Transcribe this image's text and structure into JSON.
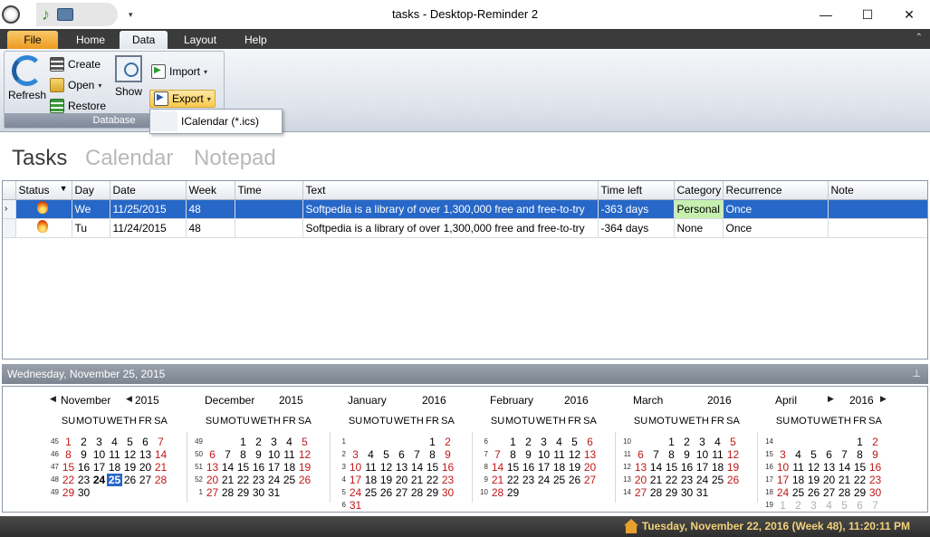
{
  "window": {
    "title": "tasks - Desktop-Reminder 2",
    "minimize": "—",
    "maximize": "☐",
    "close": "✕"
  },
  "qat": {
    "dropdown": "▾"
  },
  "ribbon": {
    "tabs": [
      "File",
      "Home",
      "Data",
      "Layout",
      "Help"
    ],
    "active_tab": "Data",
    "collapse": "⌃",
    "group_label": "Database",
    "buttons": {
      "refresh": "Refresh",
      "create": "Create",
      "open": "Open",
      "restore": "Restore",
      "show": "Show",
      "import": "Import",
      "export": "Export"
    },
    "export_menu": [
      "ICalendar (*.ics)"
    ]
  },
  "views": [
    "Tasks",
    "Calendar",
    "Notepad"
  ],
  "grid": {
    "columns": [
      "Status",
      "Day",
      "Date",
      "Week",
      "Time",
      "Text",
      "Time left",
      "Category",
      "Recurrence",
      "Note"
    ],
    "rows": [
      {
        "day": "We",
        "date": "11/25/2015",
        "week": "48",
        "time": "",
        "text": "Softpedia is a library of over 1,300,000 free and free-to-try",
        "time_left": "-363 days",
        "category": "Personal",
        "recurrence": "Once",
        "note": ""
      },
      {
        "day": "Tu",
        "date": "11/24/2015",
        "week": "48",
        "time": "",
        "text": "Softpedia is a library of over 1,300,000 free and free-to-try",
        "time_left": "-364 days",
        "category": "None",
        "recurrence": "Once",
        "note": ""
      }
    ]
  },
  "calendar": {
    "header": "Wednesday, November 25, 2015",
    "pin": "⊥",
    "dow": [
      "SU",
      "MO",
      "TU",
      "WE",
      "TH",
      "FR",
      "SA"
    ],
    "months": [
      {
        "name": "November",
        "year": "2015",
        "weeks": [
          "45",
          "46",
          "47",
          "48",
          "49"
        ],
        "rows": [
          [
            "1",
            "2",
            "3",
            "4",
            "5",
            "6",
            "7"
          ],
          [
            "8",
            "9",
            "10",
            "11",
            "12",
            "13",
            "14"
          ],
          [
            "15",
            "16",
            "17",
            "18",
            "19",
            "20",
            "21"
          ],
          [
            "22",
            "23",
            "24",
            "25",
            "26",
            "27",
            "28"
          ],
          [
            "29",
            "30",
            "",
            "",
            "",
            "",
            ""
          ]
        ]
      },
      {
        "name": "December",
        "year": "2015",
        "weeks": [
          "49",
          "50",
          "51",
          "52",
          "1"
        ],
        "rows": [
          [
            "",
            "",
            "1",
            "2",
            "3",
            "4",
            "5"
          ],
          [
            "6",
            "7",
            "8",
            "9",
            "10",
            "11",
            "12"
          ],
          [
            "13",
            "14",
            "15",
            "16",
            "17",
            "18",
            "19"
          ],
          [
            "20",
            "21",
            "22",
            "23",
            "24",
            "25",
            "26"
          ],
          [
            "27",
            "28",
            "29",
            "30",
            "31",
            "",
            ""
          ]
        ]
      },
      {
        "name": "January",
        "year": "2016",
        "weeks": [
          "1",
          "2",
          "3",
          "4",
          "5",
          "6"
        ],
        "rows": [
          [
            "",
            "",
            "",
            "",
            "",
            "1",
            "2"
          ],
          [
            "3",
            "4",
            "5",
            "6",
            "7",
            "8",
            "9"
          ],
          [
            "10",
            "11",
            "12",
            "13",
            "14",
            "15",
            "16"
          ],
          [
            "17",
            "18",
            "19",
            "20",
            "21",
            "22",
            "23"
          ],
          [
            "24",
            "25",
            "26",
            "27",
            "28",
            "29",
            "30"
          ],
          [
            "31",
            "",
            "",
            "",
            "",
            "",
            ""
          ]
        ]
      },
      {
        "name": "February",
        "year": "2016",
        "weeks": [
          "6",
          "7",
          "8",
          "9",
          "10"
        ],
        "rows": [
          [
            "",
            "1",
            "2",
            "3",
            "4",
            "5",
            "6"
          ],
          [
            "7",
            "8",
            "9",
            "10",
            "11",
            "12",
            "13"
          ],
          [
            "14",
            "15",
            "16",
            "17",
            "18",
            "19",
            "20"
          ],
          [
            "21",
            "22",
            "23",
            "24",
            "25",
            "26",
            "27"
          ],
          [
            "28",
            "29",
            "",
            "",
            "",
            "",
            ""
          ]
        ]
      },
      {
        "name": "March",
        "year": "2016",
        "weeks": [
          "10",
          "11",
          "12",
          "13",
          "14"
        ],
        "rows": [
          [
            "",
            "",
            "1",
            "2",
            "3",
            "4",
            "5"
          ],
          [
            "6",
            "7",
            "8",
            "9",
            "10",
            "11",
            "12"
          ],
          [
            "13",
            "14",
            "15",
            "16",
            "17",
            "18",
            "19"
          ],
          [
            "20",
            "21",
            "22",
            "23",
            "24",
            "25",
            "26"
          ],
          [
            "27",
            "28",
            "29",
            "30",
            "31",
            "",
            ""
          ]
        ]
      },
      {
        "name": "April",
        "year": "2016",
        "weeks": [
          "14",
          "15",
          "16",
          "17",
          "18",
          "19"
        ],
        "rows": [
          [
            "",
            "",
            "",
            "",
            "",
            "1",
            "2"
          ],
          [
            "3",
            "4",
            "5",
            "6",
            "7",
            "8",
            "9"
          ],
          [
            "10",
            "11",
            "12",
            "13",
            "14",
            "15",
            "16"
          ],
          [
            "17",
            "18",
            "19",
            "20",
            "21",
            "22",
            "23"
          ],
          [
            "24",
            "25",
            "26",
            "27",
            "28",
            "29",
            "30"
          ],
          [
            "1",
            "2",
            "3",
            "4",
            "5",
            "6",
            "7"
          ]
        ]
      }
    ],
    "today": "24",
    "selected": "25"
  },
  "status": {
    "datetime": "Tuesday, November 22, 2016 (Week 48), 11:20:11 PM"
  }
}
